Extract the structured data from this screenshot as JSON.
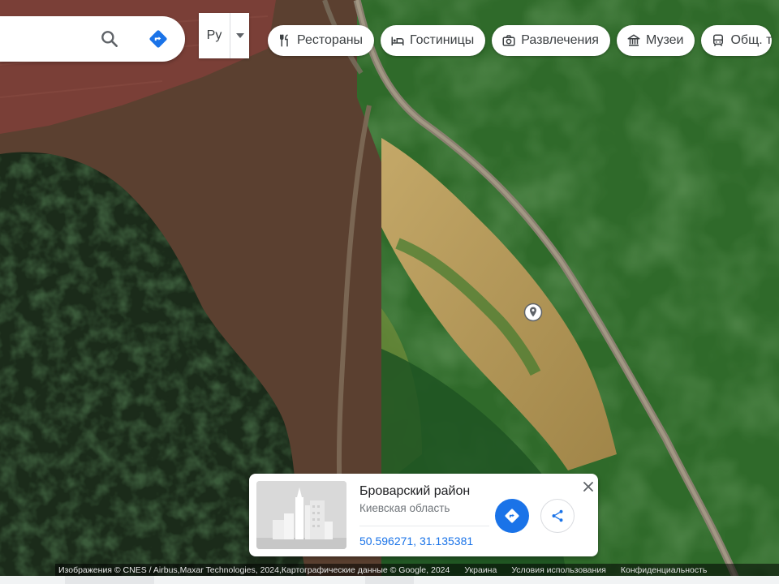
{
  "search": {
    "value": "",
    "placeholder": "",
    "search_icon": "search-icon",
    "directions_icon": "directions-icon"
  },
  "language": {
    "selected": "Ру"
  },
  "chips": [
    {
      "label": "Рестораны",
      "icon": "restaurant-icon"
    },
    {
      "label": "Гостиницы",
      "icon": "hotel-icon"
    },
    {
      "label": "Развлечения",
      "icon": "camera-icon"
    },
    {
      "label": "Музеи",
      "icon": "museum-icon"
    },
    {
      "label": "Общ. т",
      "icon": "transit-icon"
    }
  ],
  "map": {
    "imagery": "satellite",
    "pin_icon": "map-pin-icon"
  },
  "place_card": {
    "title": "Броварский район",
    "subtitle": "Киевская область",
    "coordinates": "50.596271, 31.135381",
    "directions_icon": "directions-icon",
    "share_icon": "share-icon",
    "close_icon": "close-icon"
  },
  "attribution": {
    "credits": "Изображения © CNES / Airbus,Maxar Technologies, 2024,Картографические данные © Google, 2024",
    "country": "Украина",
    "terms": "Условия использования",
    "privacy": "Конфиденциальность"
  },
  "colors": {
    "accent_blue": "#1a73e8",
    "field_green": "#2f6a2a",
    "dry_field": "#b59a5a",
    "brown_field": "#6e3e33"
  }
}
